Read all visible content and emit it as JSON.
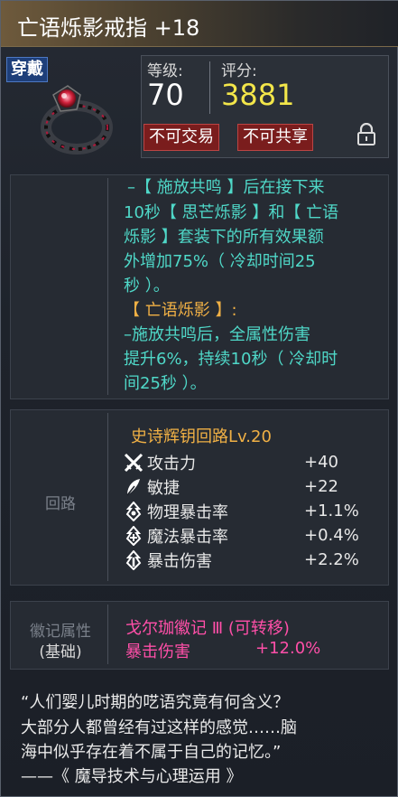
{
  "title": "亡语烁影戒指 +18",
  "equip_badge": "穿戴",
  "level_label": "等级:",
  "level_value": "70",
  "score_label": "评分:",
  "score_value": "3881",
  "tags": [
    "不可交易",
    "不可共享"
  ],
  "effect_lines": [
    {
      "text": "–【 施放共鸣 】后在接下来",
      "color": "cyan"
    },
    {
      "text": "10秒【 思芒烁影 】和【 亡语",
      "color": "cyan"
    },
    {
      "text": "烁影 】套装下的所有效果额",
      "color": "cyan"
    },
    {
      "text": "外增加75%（ 冷却时间25",
      "color": "cyan"
    },
    {
      "text": "秒 ）。",
      "color": "cyan"
    },
    {
      "text": "【 亡语烁影 】:",
      "color": "gold"
    },
    {
      "text": " –施放共鸣后，全属性伤害",
      "color": "cyan"
    },
    {
      "text": "提升6%，持续10秒（ 冷却时",
      "color": "cyan"
    },
    {
      "text": "间25秒 ）。",
      "color": "cyan"
    }
  ],
  "circuit": {
    "label": "回路",
    "name": "史诗辉钥回路Lv.20",
    "stats": [
      {
        "name": "攻击力",
        "value": "+40",
        "icon": "sword-icon"
      },
      {
        "name": "敏捷",
        "value": "+22",
        "icon": "feather-icon"
      },
      {
        "name": "物理暴击率",
        "value": "+1.1%",
        "icon": "crit-icon"
      },
      {
        "name": "魔法暴击率",
        "value": "+0.4%",
        "icon": "magic-crit-icon"
      },
      {
        "name": "暴击伤害",
        "value": "+2.2%",
        "icon": "crit-damage-icon"
      }
    ]
  },
  "emblem": {
    "label_line1": "徽记属性",
    "label_line2": "(基础)",
    "name": "戈尔珈徽记 Ⅲ (可转移)",
    "stat_name": "暴击伤害",
    "stat_value": "+12.0%"
  },
  "quote_lines": [
    "“人们婴儿时期的呓语究竟有何含义？",
    "大部分人都曾经有过这样的感觉……脑",
    "海中似乎存在着不属于自己的记忆。”",
    "——《 魔导技术与心理运用 》"
  ]
}
